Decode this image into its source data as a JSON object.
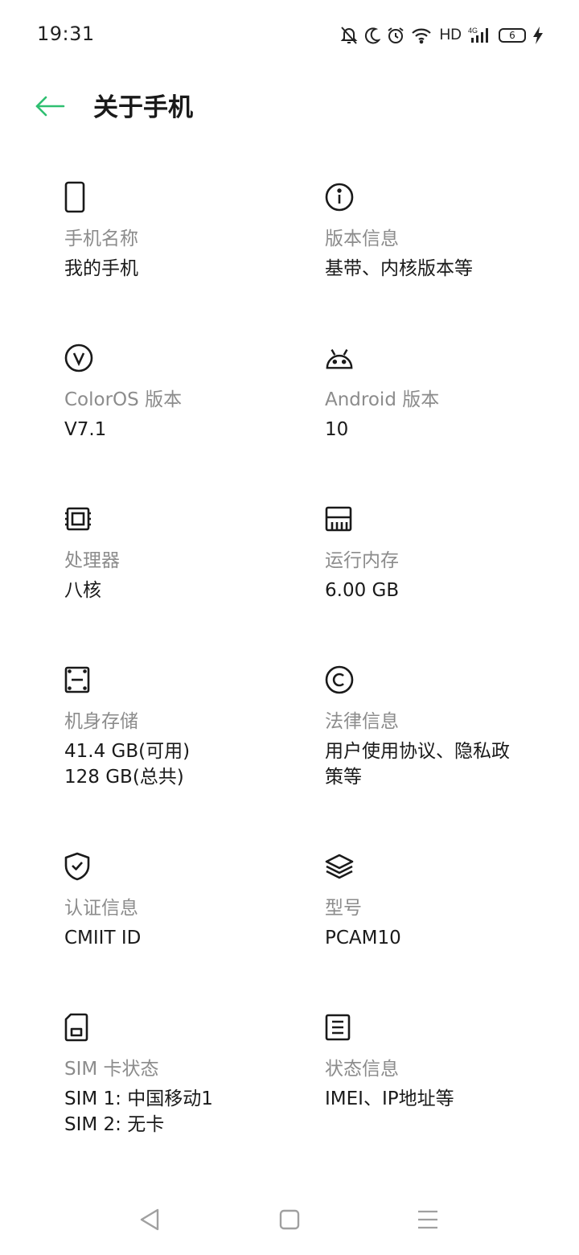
{
  "status_bar": {
    "time": "19:31",
    "hd": "HD",
    "network": "4G",
    "battery_level": "6"
  },
  "header": {
    "title": "关于手机",
    "back_icon": "arrow-left-icon",
    "accent_color": "#2fbf71"
  },
  "items": [
    {
      "icon": "phone-icon",
      "label": "手机名称",
      "value": "我的手机",
      "value2": ""
    },
    {
      "icon": "info-icon",
      "label": "版本信息",
      "value": "基带、内核版本等",
      "value2": ""
    },
    {
      "icon": "coloros-v-icon",
      "label": "ColorOS 版本",
      "value": "V7.1",
      "value2": ""
    },
    {
      "icon": "android-icon",
      "label": "Android 版本",
      "value": "10",
      "value2": ""
    },
    {
      "icon": "processor-icon",
      "label": "处理器",
      "value": "八核",
      "value2": ""
    },
    {
      "icon": "memory-icon",
      "label": "运行内存",
      "value": "6.00 GB",
      "value2": ""
    },
    {
      "icon": "storage-icon",
      "label": "机身存储",
      "value": "41.4 GB(可用)",
      "value2": "128 GB(总共)"
    },
    {
      "icon": "copyright-icon",
      "label": "法律信息",
      "value": "用户使用协议、隐私政",
      "value2": "策等"
    },
    {
      "icon": "shield-check-icon",
      "label": "认证信息",
      "value": "CMIIT ID",
      "value2": ""
    },
    {
      "icon": "layers-icon",
      "label": "型号",
      "value": "PCAM10",
      "value2": ""
    },
    {
      "icon": "sim-card-icon",
      "label": "SIM 卡状态",
      "value": "SIM 1: 中国移动1",
      "value2": "SIM 2: 无卡"
    },
    {
      "icon": "document-icon",
      "label": "状态信息",
      "value": "IMEI、IP地址等",
      "value2": ""
    }
  ],
  "nav_bar": {
    "back": "triangle-back-icon",
    "home": "square-home-icon",
    "menu": "menu-lines-icon"
  }
}
